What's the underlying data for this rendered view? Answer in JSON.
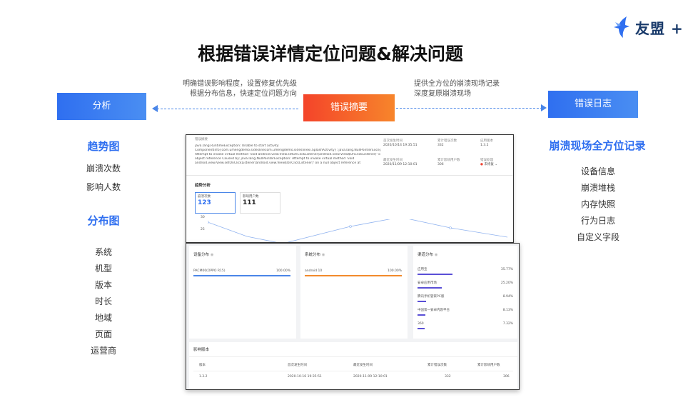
{
  "logo": {
    "text": "友盟 +"
  },
  "title": "根据错误详情定位问题&解决问题",
  "notes": {
    "left_line1": "明确错误影响程度，设置修复优先级",
    "left_line2": "根据分布信息，快速定位问题方向",
    "right_line1": "提供全方位的崩溃现场记录",
    "right_line2": "深度复原崩溃现场"
  },
  "boxes": {
    "left": "分析",
    "center": "错误摘要",
    "right": "错误日志"
  },
  "left_panel": {
    "trend_heading": "趋势图",
    "trend_items": [
      "崩溃次数",
      "影响人数"
    ],
    "dist_heading": "分布图",
    "dist_items": [
      "系统",
      "机型",
      "版本",
      "时长",
      "地域",
      "页面",
      "运营商"
    ]
  },
  "right_panel": {
    "heading": "崩溃现场全方位记录",
    "items": [
      "设备信息",
      "崩溃堆栈",
      "内存快照",
      "行为日志",
      "自定义字段"
    ]
  },
  "dashboard": {
    "summary_label": "错误摘要",
    "summary_text": [
      "java.lang.RuntimeException: Unable to start activity",
      "ComponentInfo{com.umengdemo.sideslinecom.umengdemo.sideslinexi.SplashActivity}: java.lang.NullPointerException:",
      "Attempt to invoke virtual method 'void android.view.View.setOnClickListener(android.view.View$OnClickListener)' on a null",
      "object reference Caused by: java.lang.NullPointerException: Attempt to invoke virtual method 'void",
      "android.view.View.setOnClickListener(android.view.View$OnClickListener)' on a null object reference at"
    ],
    "meta": {
      "first_time_label": "首次发生时间",
      "first_time": "2020/10/14 19:35:51",
      "total_label": "累计错误次数",
      "total": "332",
      "version_label": "应用版本",
      "version": "1.3.2",
      "last_time_label": "最近发生时间",
      "last_time": "2020/11/09 12:10:01",
      "users_label": "累计影响用户数",
      "users": "306",
      "status_label": "错误处理",
      "status": "未修复"
    },
    "trend_title": "趋势分析",
    "kpi1_label": "崩溃次数",
    "kpi1_value": "123",
    "kpi2_label": "影响用户数",
    "kpi2_value": "111",
    "y_ticks": [
      "30",
      "25"
    ],
    "device": {
      "title": "设备分布",
      "row": "PACM00(OPPO R15)",
      "pct": "100.00%"
    },
    "system": {
      "title": "系统分布",
      "row": "android 10",
      "pct": "100.00%"
    },
    "channel": {
      "title": "渠道分布",
      "rows": [
        {
          "name": "应用宝",
          "pct": "35.77%"
        },
        {
          "name": "安卓应用市场",
          "pct": "25.20%"
        },
        {
          "name": "腾讯手机管家PC版",
          "pct": "8.94%"
        },
        {
          "name": "中国第一安卓内容平台",
          "pct": "8.13%"
        },
        {
          "name": "360",
          "pct": "7.32%"
        }
      ]
    },
    "version_table": {
      "title": "影响版本",
      "headers": [
        "版本",
        "首次发生时间",
        "最近发生时间",
        "累计错误次数",
        "累计影响用户数"
      ],
      "row": [
        "1.3.2",
        "2020-10-16 19:35:51",
        "2020-11-09 12:10:01",
        "332",
        "306"
      ]
    }
  }
}
